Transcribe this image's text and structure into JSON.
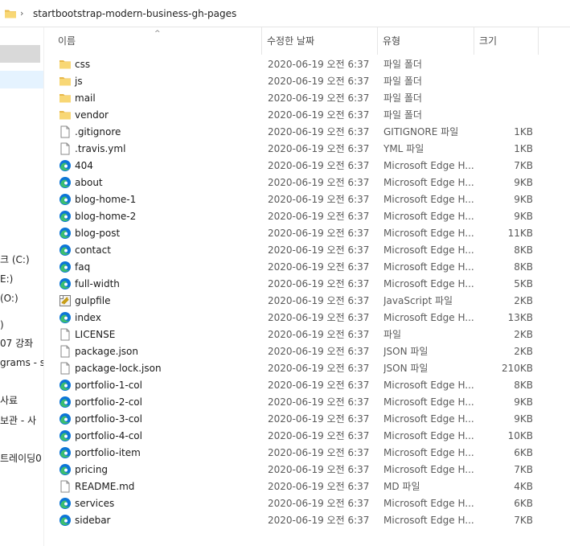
{
  "address": {
    "path": "startbootstrap-modern-business-gh-pages",
    "folder_icon": "folder-icon",
    "separator_icon": "chevron-right-icon"
  },
  "nav": {
    "items": [
      {
        "label": "",
        "state": "grey"
      },
      {
        "label": "",
        "state": "blue"
      },
      {
        "label": "크 (C:)"
      },
      {
        "label": "E:)"
      },
      {
        "label": "(O:)"
      },
      {
        "label": ")"
      },
      {
        "label": "07 강좌"
      },
      {
        "label": "grams - s"
      },
      {
        "label": "사료"
      },
      {
        "label": "보관 - 사"
      },
      {
        "label": "트레이딩0"
      }
    ]
  },
  "columns": {
    "name": "이름",
    "date": "수정한 날짜",
    "type": "유형",
    "size": "크기"
  },
  "colors": {
    "folder": "#f8d775",
    "folder_dark": "#e8b84a",
    "edge_blue": "#0c75d8",
    "edge_green": "#3cbf6e",
    "selected_bg": "#e5f3ff"
  },
  "files": [
    {
      "name": "css",
      "icon": "folder-icon",
      "date": "2020-06-19 오전 6:37",
      "type": "파일 폴더",
      "size": ""
    },
    {
      "name": "js",
      "icon": "folder-icon",
      "date": "2020-06-19 오전 6:37",
      "type": "파일 폴더",
      "size": ""
    },
    {
      "name": "mail",
      "icon": "folder-icon",
      "date": "2020-06-19 오전 6:37",
      "type": "파일 폴더",
      "size": ""
    },
    {
      "name": "vendor",
      "icon": "folder-icon",
      "date": "2020-06-19 오전 6:37",
      "type": "파일 폴더",
      "size": ""
    },
    {
      "name": ".gitignore",
      "icon": "file-icon",
      "date": "2020-06-19 오전 6:37",
      "type": "GITIGNORE 파일",
      "size": "1KB"
    },
    {
      "name": ".travis.yml",
      "icon": "file-icon",
      "date": "2020-06-19 오전 6:37",
      "type": "YML 파일",
      "size": "1KB"
    },
    {
      "name": "404",
      "icon": "edge-icon",
      "date": "2020-06-19 오전 6:37",
      "type": "Microsoft Edge H...",
      "size": "7KB"
    },
    {
      "name": "about",
      "icon": "edge-icon",
      "date": "2020-06-19 오전 6:37",
      "type": "Microsoft Edge H...",
      "size": "9KB"
    },
    {
      "name": "blog-home-1",
      "icon": "edge-icon",
      "date": "2020-06-19 오전 6:37",
      "type": "Microsoft Edge H...",
      "size": "9KB"
    },
    {
      "name": "blog-home-2",
      "icon": "edge-icon",
      "date": "2020-06-19 오전 6:37",
      "type": "Microsoft Edge H...",
      "size": "9KB"
    },
    {
      "name": "blog-post",
      "icon": "edge-icon",
      "date": "2020-06-19 오전 6:37",
      "type": "Microsoft Edge H...",
      "size": "11KB"
    },
    {
      "name": "contact",
      "icon": "edge-icon",
      "date": "2020-06-19 오전 6:37",
      "type": "Microsoft Edge H...",
      "size": "8KB"
    },
    {
      "name": "faq",
      "icon": "edge-icon",
      "date": "2020-06-19 오전 6:37",
      "type": "Microsoft Edge H...",
      "size": "8KB"
    },
    {
      "name": "full-width",
      "icon": "edge-icon",
      "date": "2020-06-19 오전 6:37",
      "type": "Microsoft Edge H...",
      "size": "5KB"
    },
    {
      "name": "gulpfile",
      "icon": "script-icon",
      "date": "2020-06-19 오전 6:37",
      "type": "JavaScript 파일",
      "size": "2KB"
    },
    {
      "name": "index",
      "icon": "edge-icon",
      "date": "2020-06-19 오전 6:37",
      "type": "Microsoft Edge H...",
      "size": "13KB"
    },
    {
      "name": "LICENSE",
      "icon": "file-icon",
      "date": "2020-06-19 오전 6:37",
      "type": "파일",
      "size": "2KB"
    },
    {
      "name": "package.json",
      "icon": "file-icon",
      "date": "2020-06-19 오전 6:37",
      "type": "JSON 파일",
      "size": "2KB"
    },
    {
      "name": "package-lock.json",
      "icon": "file-icon",
      "date": "2020-06-19 오전 6:37",
      "type": "JSON 파일",
      "size": "210KB"
    },
    {
      "name": "portfolio-1-col",
      "icon": "edge-icon",
      "date": "2020-06-19 오전 6:37",
      "type": "Microsoft Edge H...",
      "size": "8KB"
    },
    {
      "name": "portfolio-2-col",
      "icon": "edge-icon",
      "date": "2020-06-19 오전 6:37",
      "type": "Microsoft Edge H...",
      "size": "9KB"
    },
    {
      "name": "portfolio-3-col",
      "icon": "edge-icon",
      "date": "2020-06-19 오전 6:37",
      "type": "Microsoft Edge H...",
      "size": "9KB"
    },
    {
      "name": "portfolio-4-col",
      "icon": "edge-icon",
      "date": "2020-06-19 오전 6:37",
      "type": "Microsoft Edge H...",
      "size": "10KB"
    },
    {
      "name": "portfolio-item",
      "icon": "edge-icon",
      "date": "2020-06-19 오전 6:37",
      "type": "Microsoft Edge H...",
      "size": "6KB"
    },
    {
      "name": "pricing",
      "icon": "edge-icon",
      "date": "2020-06-19 오전 6:37",
      "type": "Microsoft Edge H...",
      "size": "7KB"
    },
    {
      "name": "README.md",
      "icon": "file-icon",
      "date": "2020-06-19 오전 6:37",
      "type": "MD 파일",
      "size": "4KB"
    },
    {
      "name": "services",
      "icon": "edge-icon",
      "date": "2020-06-19 오전 6:37",
      "type": "Microsoft Edge H...",
      "size": "6KB"
    },
    {
      "name": "sidebar",
      "icon": "edge-icon",
      "date": "2020-06-19 오전 6:37",
      "type": "Microsoft Edge H...",
      "size": "7KB"
    }
  ]
}
